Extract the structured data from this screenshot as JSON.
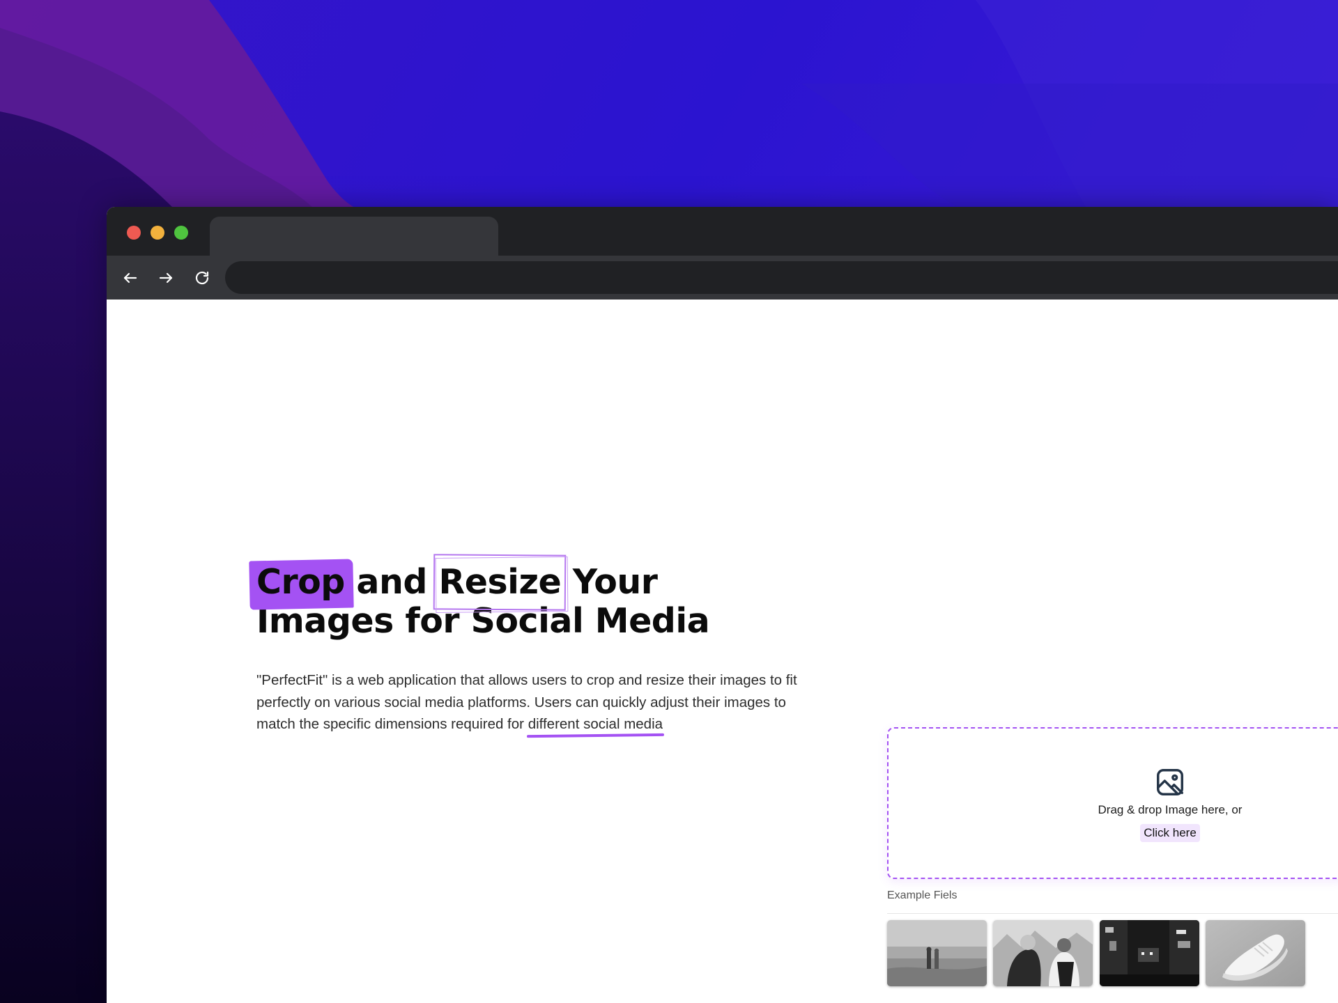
{
  "window": {
    "controls": [
      "close",
      "minimize",
      "maximize"
    ],
    "tab_title": "",
    "address": ""
  },
  "hero": {
    "title_word1": "Crop",
    "title_word2": " and ",
    "title_word3": "Resize",
    "title_rest": " Your Images for Social Media",
    "desc_main": "\"PerfectFit\" is a web application that allows users to crop and resize their images to fit perfectly on various social media platforms. Users can quickly adjust their images to match the specific dimensions required for ",
    "desc_underlined": "different social media"
  },
  "upload": {
    "icon": "image-icon",
    "drop_text": "Drag & drop Image here, or",
    "click_label": "Click here",
    "accent": "#a452f3"
  },
  "examples": {
    "label": "Example Fiels",
    "items": [
      {
        "name": "beach-couple-photo"
      },
      {
        "name": "snow-couple-photo"
      },
      {
        "name": "night-street-photo"
      },
      {
        "name": "sneaker-photo"
      }
    ]
  },
  "colors": {
    "accent": "#a452f3",
    "titlebar": "#202124",
    "toolbar": "#35363a"
  }
}
